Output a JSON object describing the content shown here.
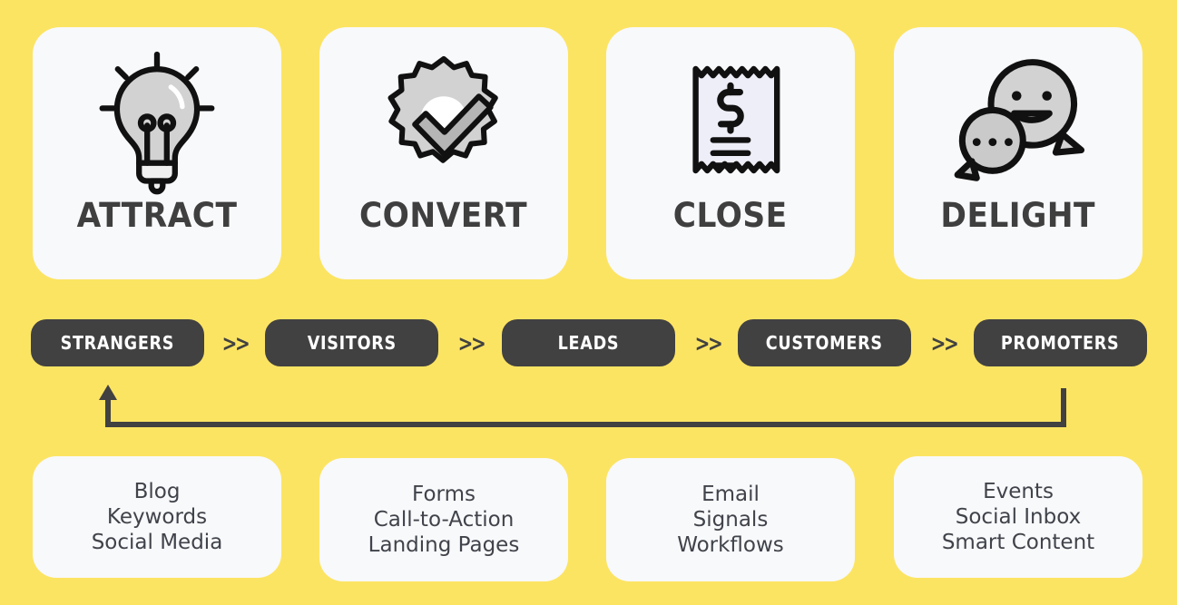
{
  "theme": {
    "background": "#FCE463",
    "card_bg": "#F8F9FB",
    "pill_bg": "#414141",
    "pill_text": "#FFFFFF",
    "heading_text": "#3F3F3F",
    "body_text": "#40434A",
    "icon_outline": "#111111",
    "icon_fill": "#D2D2D2"
  },
  "stages": [
    {
      "label": "ATTRACT",
      "icon": "lightbulb-icon"
    },
    {
      "label": "CONVERT",
      "icon": "gear-check-icon"
    },
    {
      "label": "CLOSE",
      "icon": "receipt-dollar-icon"
    },
    {
      "label": "DELIGHT",
      "icon": "speech-bubbles-icon"
    }
  ],
  "funnel": {
    "separator": ">>",
    "steps": [
      {
        "label": "STRANGERS"
      },
      {
        "label": "VISITORS"
      },
      {
        "label": "LEADS"
      },
      {
        "label": "CUSTOMERS"
      },
      {
        "label": "PROMOTERS"
      }
    ]
  },
  "loop": {
    "name": "feedback-loop-arrow",
    "direction": "promoters-to-strangers"
  },
  "tactics": [
    {
      "lines": [
        "Blog",
        "Keywords",
        "Social Media"
      ]
    },
    {
      "lines": [
        "Forms",
        "Call-to-Action",
        "Landing Pages"
      ]
    },
    {
      "lines": [
        "Email",
        "Signals",
        "Workflows"
      ]
    },
    {
      "lines": [
        "Events",
        "Social Inbox",
        "Smart Content"
      ]
    }
  ]
}
